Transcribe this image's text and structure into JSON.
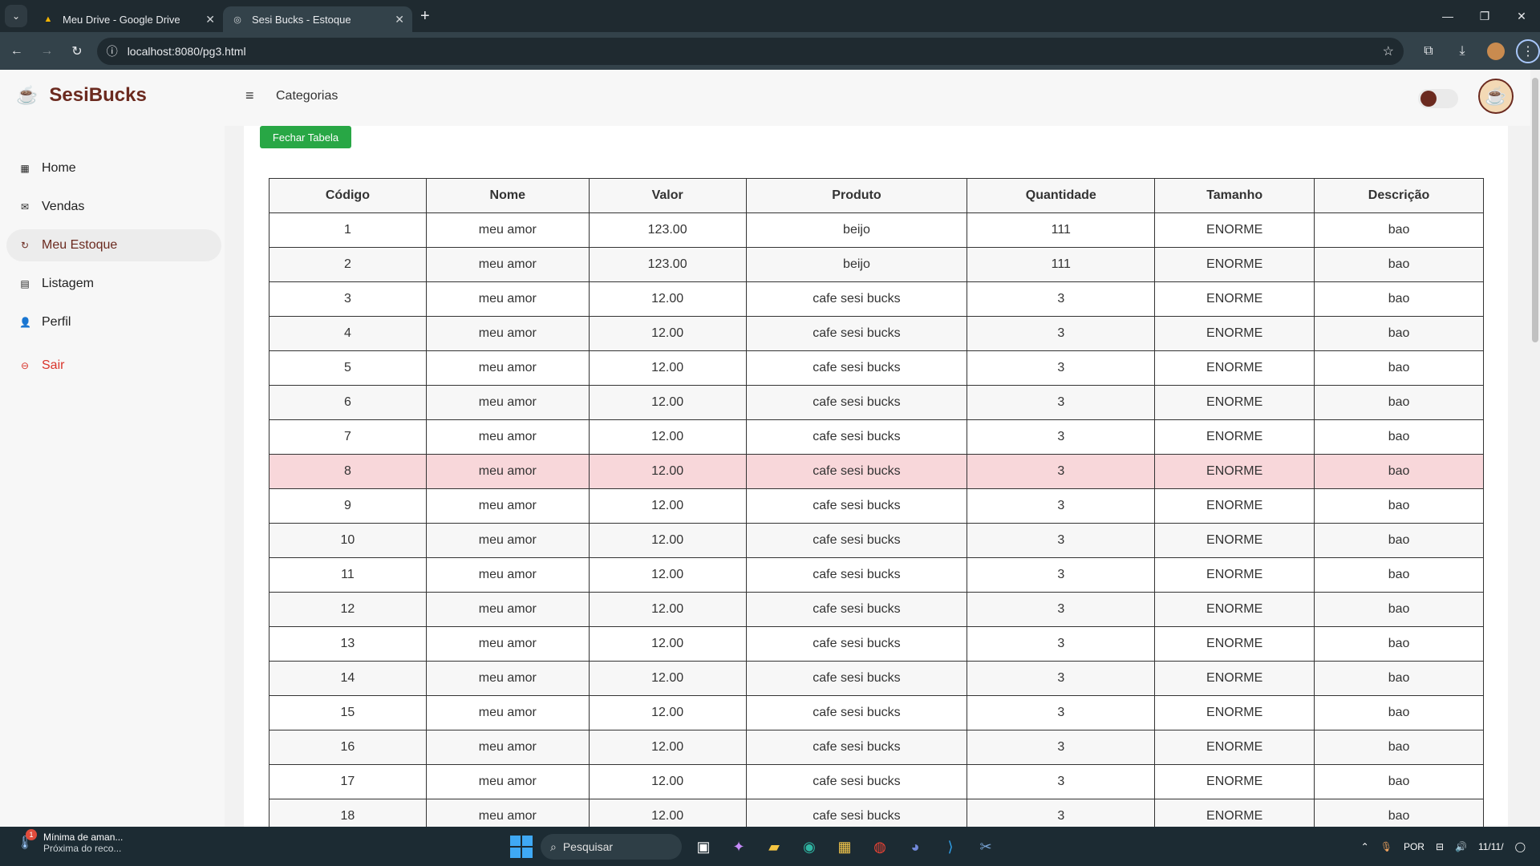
{
  "browser": {
    "tabs": [
      {
        "title": "Meu Drive - Google Drive",
        "active": false
      },
      {
        "title": "Sesi Bucks - Estoque",
        "active": true
      }
    ],
    "url": "localhost:8080/pg3.html"
  },
  "app": {
    "brand": "SesiBucks",
    "breadcrumb": "Categorias",
    "nav": [
      {
        "label": "Home",
        "icon": "grid-icon",
        "active": false
      },
      {
        "label": "Vendas",
        "icon": "envelope-icon",
        "active": false
      },
      {
        "label": "Meu Estoque",
        "icon": "refresh-icon",
        "active": true
      },
      {
        "label": "Listagem",
        "icon": "chat-icon",
        "active": false
      },
      {
        "label": "Perfil",
        "icon": "users-icon",
        "active": false
      }
    ],
    "logout": "Sair",
    "close_table_button": "Fechar Tabela",
    "table": {
      "headers": [
        "Código",
        "Nome",
        "Valor",
        "Produto",
        "Quantidade",
        "Tamanho",
        "Descrição"
      ],
      "rows": [
        [
          "1",
          "meu amor",
          "123.00",
          "beijo",
          "111",
          "ENORME",
          "bao"
        ],
        [
          "2",
          "meu amor",
          "123.00",
          "beijo",
          "111",
          "ENORME",
          "bao"
        ],
        [
          "3",
          "meu amor",
          "12.00",
          "cafe sesi bucks",
          "3",
          "ENORME",
          "bao"
        ],
        [
          "4",
          "meu amor",
          "12.00",
          "cafe sesi bucks",
          "3",
          "ENORME",
          "bao"
        ],
        [
          "5",
          "meu amor",
          "12.00",
          "cafe sesi bucks",
          "3",
          "ENORME",
          "bao"
        ],
        [
          "6",
          "meu amor",
          "12.00",
          "cafe sesi bucks",
          "3",
          "ENORME",
          "bao"
        ],
        [
          "7",
          "meu amor",
          "12.00",
          "cafe sesi bucks",
          "3",
          "ENORME",
          "bao"
        ],
        [
          "8",
          "meu amor",
          "12.00",
          "cafe sesi bucks",
          "3",
          "ENORME",
          "bao"
        ],
        [
          "9",
          "meu amor",
          "12.00",
          "cafe sesi bucks",
          "3",
          "ENORME",
          "bao"
        ],
        [
          "10",
          "meu amor",
          "12.00",
          "cafe sesi bucks",
          "3",
          "ENORME",
          "bao"
        ],
        [
          "11",
          "meu amor",
          "12.00",
          "cafe sesi bucks",
          "3",
          "ENORME",
          "bao"
        ],
        [
          "12",
          "meu amor",
          "12.00",
          "cafe sesi bucks",
          "3",
          "ENORME",
          "bao"
        ],
        [
          "13",
          "meu amor",
          "12.00",
          "cafe sesi bucks",
          "3",
          "ENORME",
          "bao"
        ],
        [
          "14",
          "meu amor",
          "12.00",
          "cafe sesi bucks",
          "3",
          "ENORME",
          "bao"
        ],
        [
          "15",
          "meu amor",
          "12.00",
          "cafe sesi bucks",
          "3",
          "ENORME",
          "bao"
        ],
        [
          "16",
          "meu amor",
          "12.00",
          "cafe sesi bucks",
          "3",
          "ENORME",
          "bao"
        ],
        [
          "17",
          "meu amor",
          "12.00",
          "cafe sesi bucks",
          "3",
          "ENORME",
          "bao"
        ],
        [
          "18",
          "meu amor",
          "12.00",
          "cafe sesi bucks",
          "3",
          "ENORME",
          "bao"
        ]
      ],
      "highlighted_row": 8
    }
  },
  "taskbar": {
    "notification_title": "Mínima de aman...",
    "notification_sub": "Próxima do reco...",
    "notification_badge": "1",
    "search_placeholder": "Pesquisar",
    "language": "POR",
    "date": "11/11/"
  },
  "colors": {
    "brand": "#6b2a1f",
    "accent_green": "#28a745",
    "highlight_row": "#f8d7da",
    "logout_red": "#d9342b"
  }
}
